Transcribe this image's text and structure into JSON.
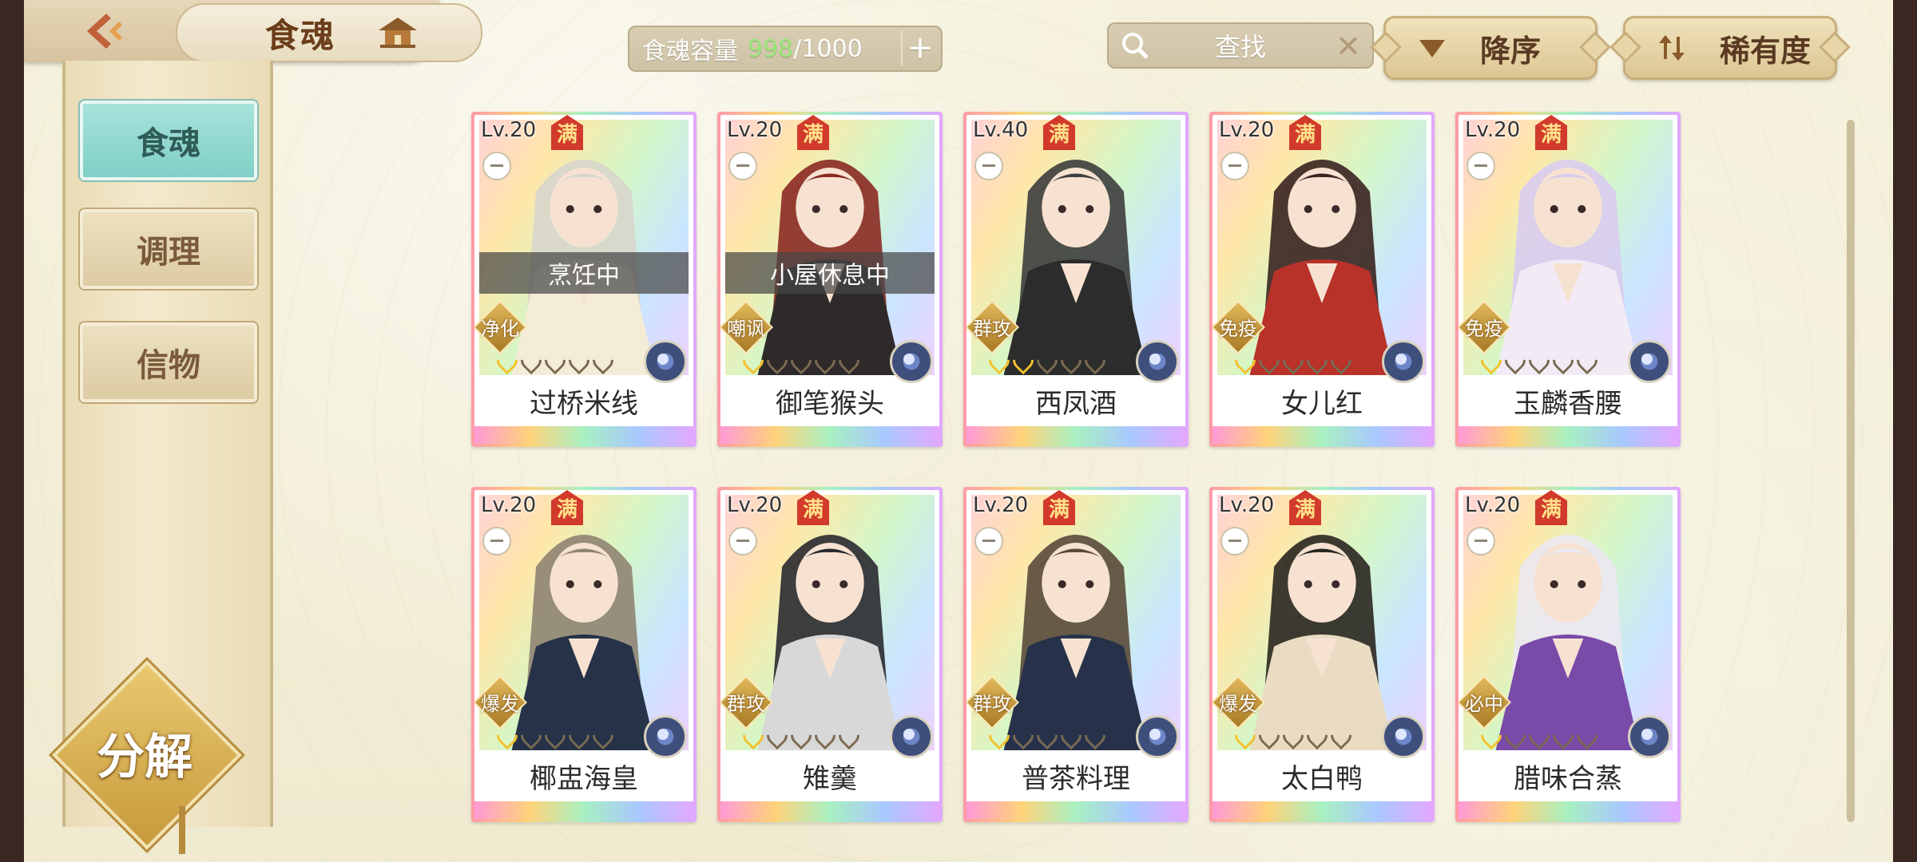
{
  "header": {
    "title": "食魂",
    "capacity_label": "食魂容量",
    "capacity_current": "998",
    "capacity_total": "/1000",
    "capacity_add": "+",
    "search_placeholder": "查找",
    "search_clear": "✕",
    "sort_order_label": "降序",
    "sort_by_label": "稀有度"
  },
  "sidebar": {
    "tabs": [
      {
        "label": "食魂",
        "active": true
      },
      {
        "label": "调理",
        "active": false
      },
      {
        "label": "信物",
        "active": false
      }
    ],
    "decompose_label": "分解"
  },
  "cards": [
    {
      "level": "Lv.20",
      "full": "满",
      "status": "烹饪中",
      "skill": "净化",
      "stars": 1,
      "name": "过桥米线",
      "hair": "#d8d6cc",
      "outfit": "#f4ecd6"
    },
    {
      "level": "Lv.20",
      "full": "满",
      "status": "小屋休息中",
      "skill": "嘲讽",
      "stars": 1,
      "name": "御笔猴头",
      "hair": "#8a2a22",
      "outfit": "#2e2a2a"
    },
    {
      "level": "Lv.40",
      "full": "满",
      "status": "",
      "skill": "群攻",
      "stars": 2,
      "name": "西凤酒",
      "hair": "#3d3d3d",
      "outfit": "#2c2c2c"
    },
    {
      "level": "Lv.20",
      "full": "满",
      "status": "",
      "skill": "免疫",
      "stars": 1,
      "name": "女儿红",
      "hair": "#3a2420",
      "outfit": "#b8322a"
    },
    {
      "level": "Lv.20",
      "full": "满",
      "status": "",
      "skill": "免疫",
      "stars": 1,
      "name": "玉麟香腰",
      "hair": "#d9ccef",
      "outfit": "#f2ebf5"
    },
    {
      "level": "Lv.20",
      "full": "满",
      "status": "",
      "skill": "爆发",
      "stars": 1,
      "name": "椰盅海皇",
      "hair": "#8f8472",
      "outfit": "#263247"
    },
    {
      "level": "Lv.20",
      "full": "满",
      "status": "",
      "skill": "群攻",
      "stars": 1,
      "name": "雉羹",
      "hair": "#2a2a30",
      "outfit": "#d8d8d8"
    },
    {
      "level": "Lv.20",
      "full": "满",
      "status": "",
      "skill": "群攻",
      "stars": 1,
      "name": "普茶料理",
      "hair": "#5a4a3a",
      "outfit": "#27324a"
    },
    {
      "level": "Lv.20",
      "full": "满",
      "status": "",
      "skill": "爆发",
      "stars": 1,
      "name": "太白鸭",
      "hair": "#2a2620",
      "outfit": "#e9dcc2"
    },
    {
      "level": "Lv.20",
      "full": "满",
      "status": "",
      "skill": "必中",
      "stars": 1,
      "name": "腊味合蒸",
      "hair": "#ece8f2",
      "outfit": "#7a4aa8"
    }
  ]
}
